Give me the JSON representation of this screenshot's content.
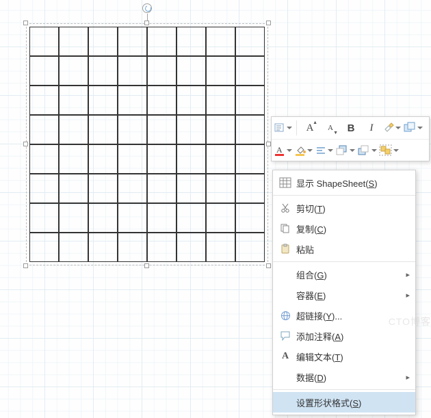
{
  "shape": {
    "rows": 8,
    "cols": 8
  },
  "mini_toolbar": {
    "row1": [
      "text-style",
      "sep",
      "font-grow",
      "font-shrink",
      "bold",
      "italic",
      "format-painter",
      "shape-styles"
    ],
    "row2": [
      "font-color",
      "fill-color",
      "align",
      "bring-front",
      "send-back",
      "group"
    ]
  },
  "context_menu": {
    "show_shapesheet": "显示 ShapeSheet",
    "show_shapesheet_k": "S",
    "cut": "剪切",
    "cut_k": "T",
    "copy": "复制",
    "copy_k": "C",
    "paste": "粘贴",
    "group": "组合",
    "group_k": "G",
    "container": "容器",
    "container_k": "E",
    "hyperlink": "超链接",
    "hyperlink_k": "Y",
    "hyperlink_suffix": "...",
    "add_comment": "添加注释",
    "add_comment_k": "A",
    "edit_text": "编辑文本",
    "edit_text_k": "T",
    "data": "数据",
    "data_k": "D",
    "format_shape": "设置形状格式",
    "format_shape_k": "S"
  },
  "watermark": "CTO博客"
}
